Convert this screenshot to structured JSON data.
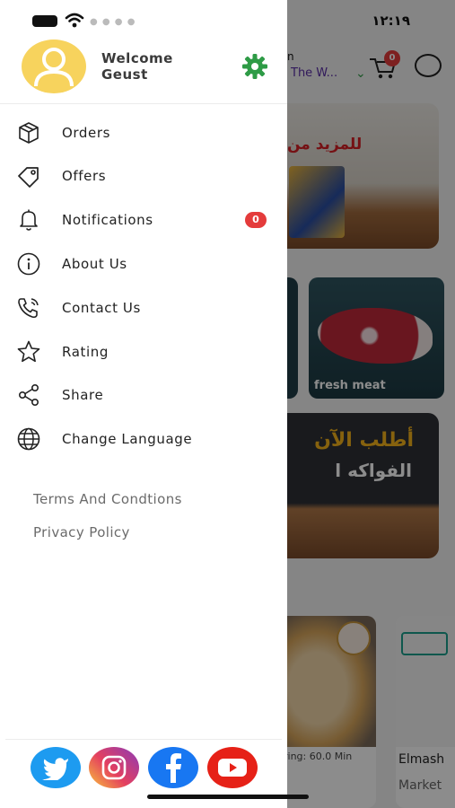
{
  "status": {
    "time": "١٢:١٩"
  },
  "background": {
    "header": {
      "address_top": "n",
      "address": "The W...",
      "cart_count": "0"
    },
    "banner_top_text": "للمزيد من",
    "category": {
      "label": "fresh meat"
    },
    "banner_mid": {
      "line1": "أطلب الآن",
      "line2": "الفواكه ا"
    },
    "product1": {
      "delivery": "ring: 60.0 Min"
    },
    "product2": {
      "name": "Elmash",
      "type": "Market"
    }
  },
  "drawer": {
    "profile": {
      "welcome": "Welcome",
      "name": "Geust"
    },
    "menu": [
      {
        "label": "Orders",
        "icon": "box-icon"
      },
      {
        "label": "Offers",
        "icon": "tag-icon"
      },
      {
        "label": "Notifications",
        "icon": "bell-icon",
        "badge": "0"
      },
      {
        "label": "About Us",
        "icon": "info-icon"
      },
      {
        "label": "Contact Us",
        "icon": "phone-icon"
      },
      {
        "label": "Rating",
        "icon": "star-icon"
      },
      {
        "label": "Share",
        "icon": "share-icon"
      },
      {
        "label": "Change Language",
        "icon": "globe-icon"
      }
    ],
    "links": {
      "terms": "Terms And Condtions",
      "privacy": "Privacy Policy"
    },
    "social": [
      "twitter-icon",
      "instagram-icon",
      "facebook-icon",
      "youtube-icon"
    ]
  },
  "colors": {
    "accent_green": "#2e9b46",
    "badge_red": "#e43b3b",
    "avatar_yellow": "#f7d35d",
    "twitter": "#1d9bf0",
    "facebook": "#1877f2",
    "youtube": "#e62117"
  }
}
